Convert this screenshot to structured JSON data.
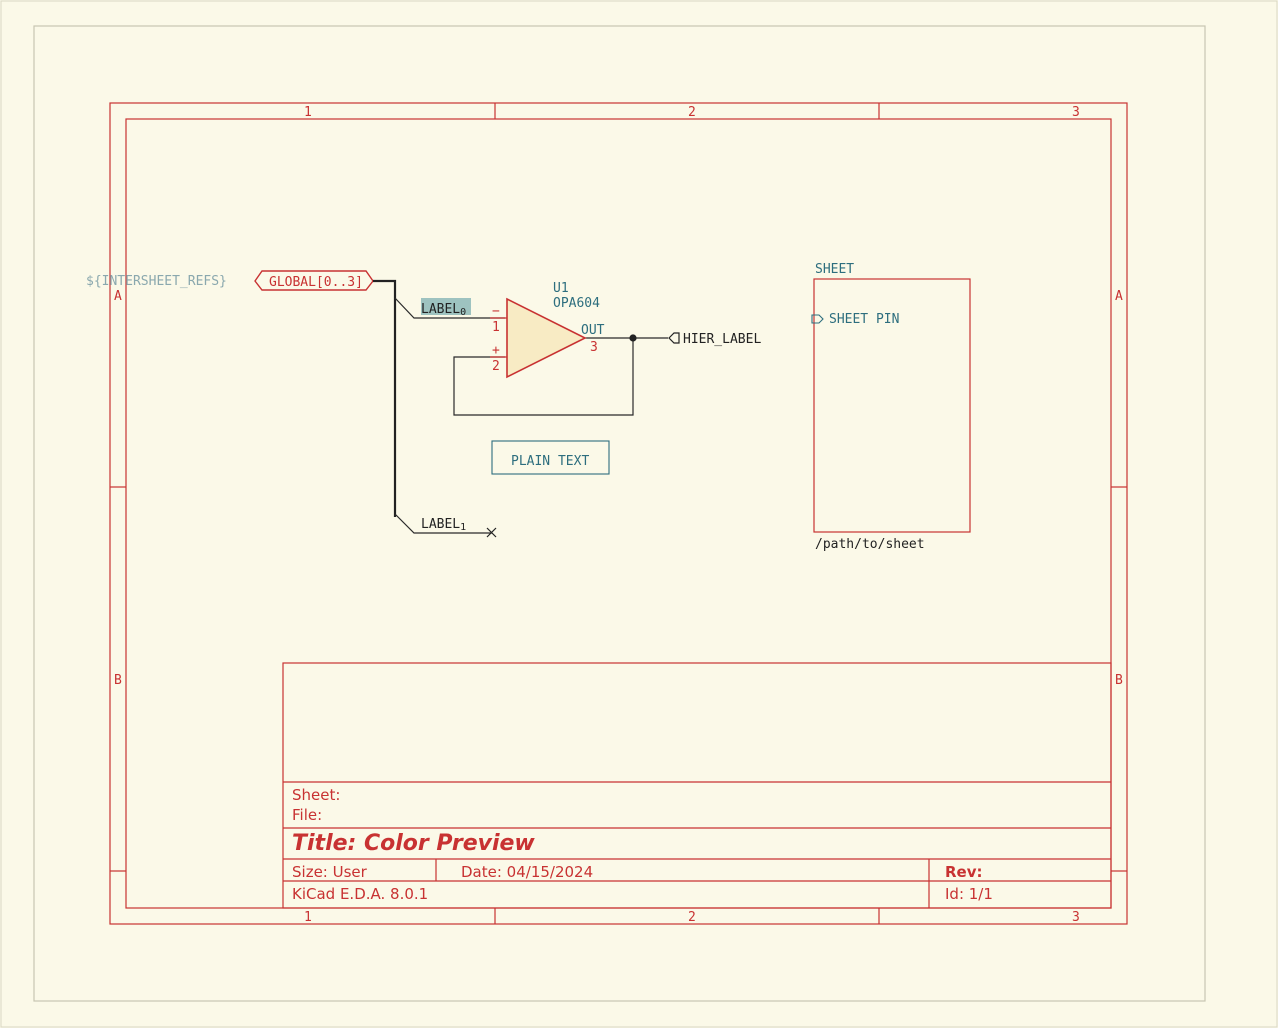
{
  "page": {
    "background": "#fbf9e8",
    "accent": "#c83232",
    "wire_color": "#2a2a2a",
    "symbol_fill": "#f8ebc4",
    "label_teal": "#2d6e7e"
  },
  "frame": {
    "columns": [
      "1",
      "2",
      "3"
    ],
    "rows": [
      "A",
      "B"
    ]
  },
  "schematic": {
    "intersheet_refs": "${INTERSHEET_REFS}",
    "global_label": "GLOBAL[0..3]",
    "label0_base": "LABEL",
    "label0_sub": "0",
    "label1_base": "LABEL",
    "label1_sub": "1",
    "opamp": {
      "reference": "U1",
      "value": "OPA604",
      "pin_minus_sign": "−",
      "pin_plus_sign": "+",
      "pin1": "1",
      "pin2": "2",
      "pin3": "3",
      "out_name": "OUT"
    },
    "hier_label": "HIER_LABEL",
    "plain_text": "PLAIN TEXT",
    "sheet": {
      "name": "SHEET",
      "pin": "SHEET PIN",
      "file": "/path/to/sheet"
    }
  },
  "title_block": {
    "sheet_label": "Sheet:",
    "file_label": "File:",
    "title": "Title: Color Preview",
    "size": "Size: User",
    "date": "Date: 04/15/2024",
    "rev": "Rev:",
    "generator": "KiCad E.D.A. 8.0.1",
    "id": "Id: 1/1"
  }
}
